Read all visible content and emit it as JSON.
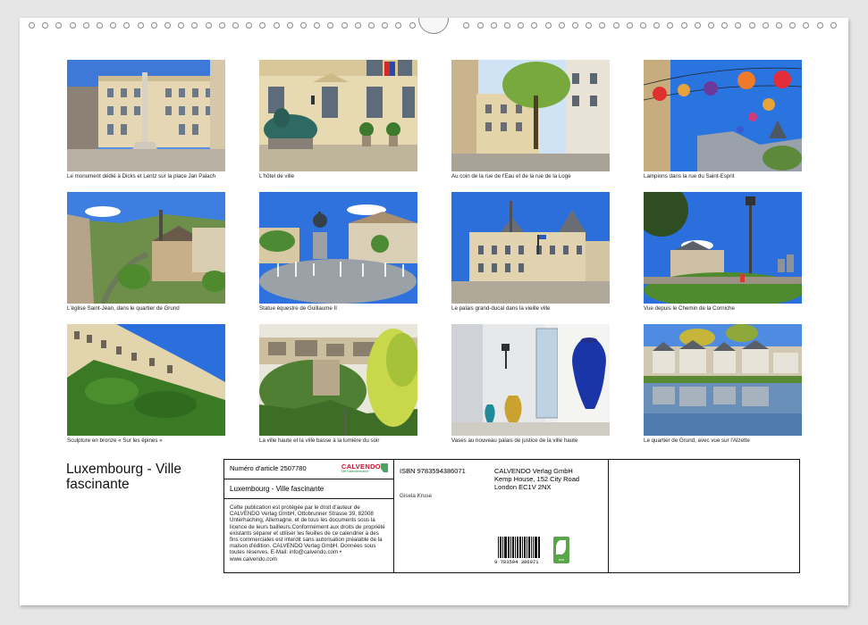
{
  "calendar": {
    "title": "Luxembourg - Ville fascinante",
    "photos": [
      {
        "caption": "Le monument dédié à Dicks et Lentz sur la place Jan Palach",
        "icon": "monument-photo"
      },
      {
        "caption": "L'hôtel de ville",
        "icon": "town-hall-photo"
      },
      {
        "caption": "Au coin de la rue de l'Eau et de la rue de la Loge",
        "icon": "street-corner-photo"
      },
      {
        "caption": "Lampions dans la rue du Saint-Esprit",
        "icon": "lanterns-photo"
      },
      {
        "caption": "L'église Saint-Jean, dans le quartier de Grund",
        "icon": "church-photo"
      },
      {
        "caption": "Statue équestre de Guillaume II",
        "icon": "equestrian-statue-photo"
      },
      {
        "caption": "Le palais grand-ducal dans la vieille ville",
        "icon": "grand-ducal-palace-photo"
      },
      {
        "caption": "Vue depuis le Chemin de la Corniche",
        "icon": "corniche-view-photo"
      },
      {
        "caption": "Sculpture en bronze « Sur les épines »",
        "icon": "ivy-building-photo"
      },
      {
        "caption": "La ville haute et la ville basse à la lumière du soir",
        "icon": "evening-city-photo"
      },
      {
        "caption": "Vases au nouveau palais de justice de la ville haute",
        "icon": "vases-photo"
      },
      {
        "caption": "Le quartier de Grund, avec vue sur l'Alzette",
        "icon": "grund-river-photo"
      }
    ]
  },
  "footer": {
    "article_number": "Numéro d'article 2507780",
    "product_title": "Luxembourg - Ville fascinante",
    "legal_text": "Cette publication est protégée par le droit d'auteur de CALVENDO Verlag GmbH, Ottobrunner Strasse 39, 82008 Unterhaching, Allemagne, et de tous les documents sous la licence de leurs bailleurs.Conformément aux droits de propriété existants séparer et utiliser les feuilles de ce calendrier à des fins commerciales est interdit sans autorisation préalable de la maison d'édition. CALVENDO Verlag GmbH. Données sous toutes réserves. E-Mail: info@calvendo.com • www.calvendo.com",
    "isbn": "ISBN 9783594386071",
    "publisher_line1": "CALVENDO Verlag GmbH",
    "publisher_line2": "Kemp House, 152 City Road",
    "publisher_line3": "London EC1V 2NX",
    "author": "Gisela Kruse",
    "barcode_number": "9 783594 386071",
    "logo_text": "CALVENDO",
    "logo_sub": "Die Kalendermarke",
    "eco_label": "eco"
  },
  "colors": {
    "sky": "#2f6fd6",
    "brand_red": "#c8102e",
    "eco_green": "#59a64a"
  }
}
